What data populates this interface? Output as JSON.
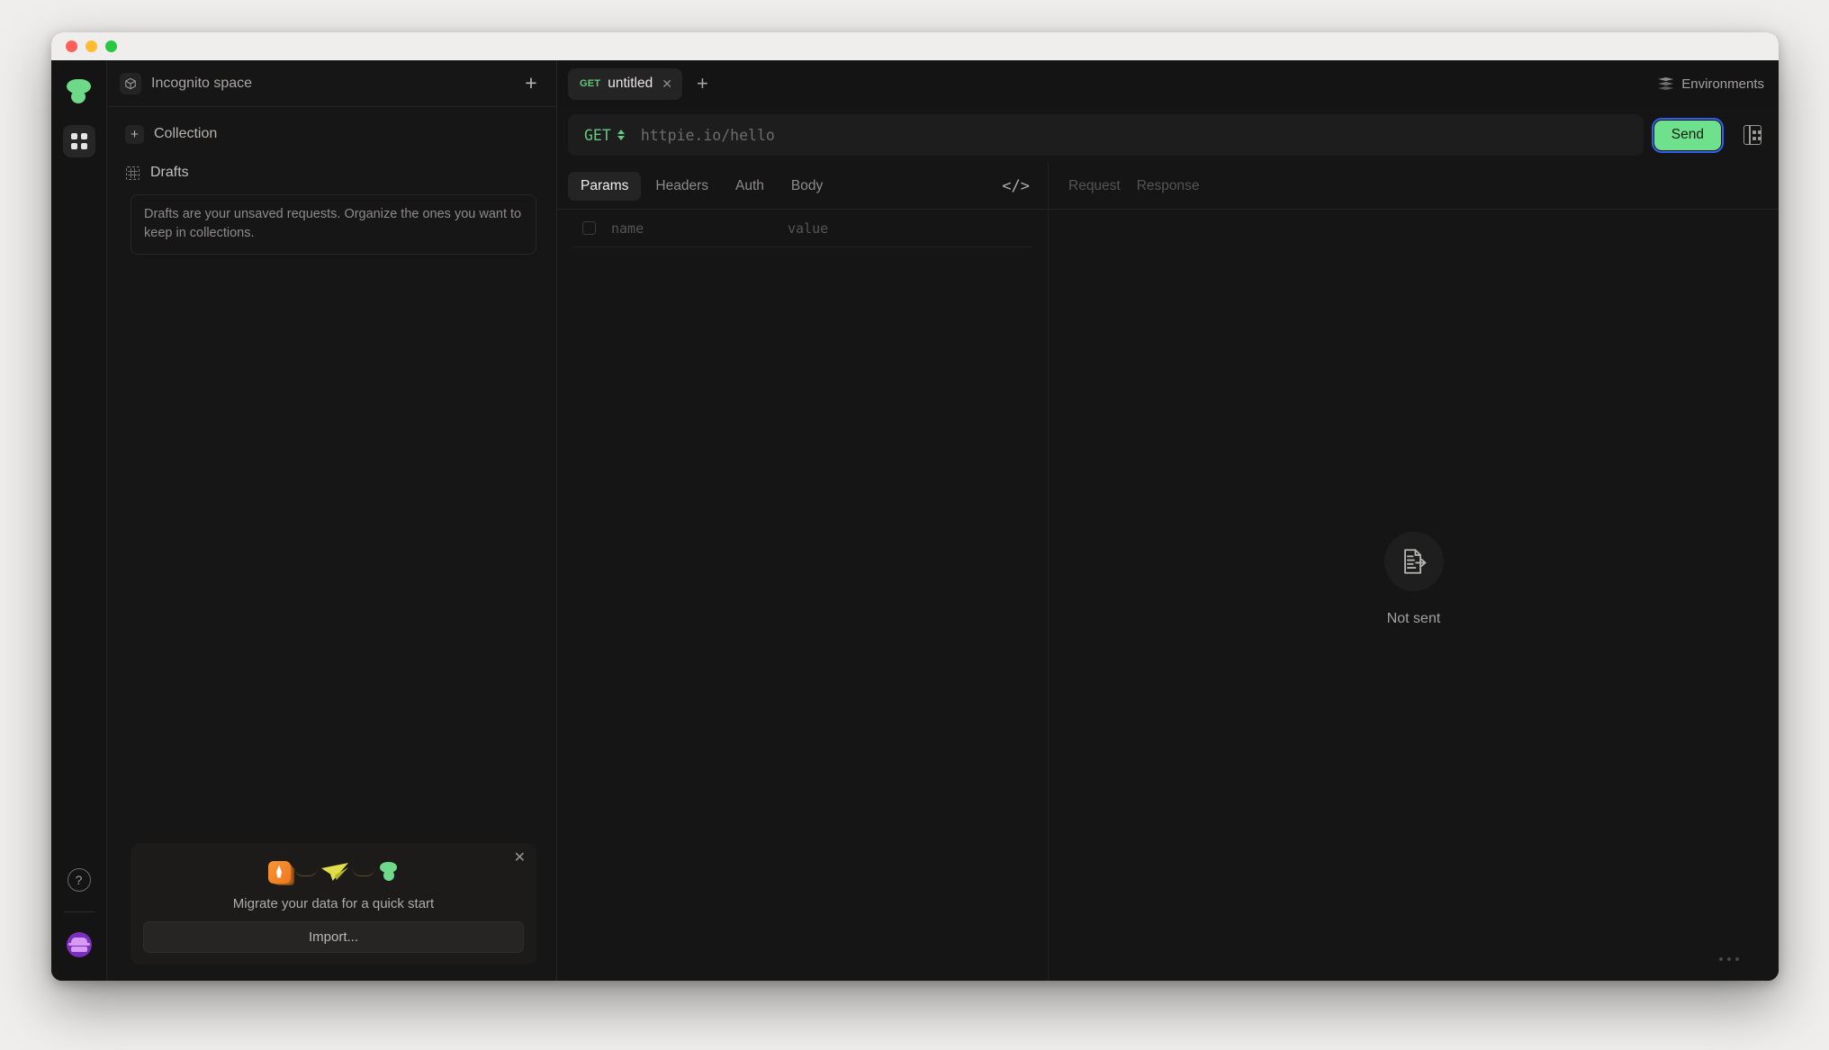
{
  "window": {
    "traffic_lights": [
      "close",
      "minimize",
      "zoom"
    ]
  },
  "rail": {
    "logo_name": "httpie-logo",
    "collections_icon": "grid-apps-icon",
    "help_label": "?",
    "avatar_name": "incognito-avatar"
  },
  "sidebar": {
    "space": {
      "icon": "cube-icon",
      "name": "Incognito space",
      "add_label": "+"
    },
    "collection": {
      "add_label": "+",
      "label": "Collection"
    },
    "drafts": {
      "icon": "dashed-grid-icon",
      "label": "Drafts",
      "note": "Drafts are your unsaved requests. Organize the ones you want to keep in collections."
    },
    "migrate": {
      "close_label": "✕",
      "art": [
        "postman-rocket-icon",
        "insomnia-plane-icon",
        "httpie-logo-icon"
      ],
      "headline": "Migrate your data for a quick start",
      "button_label": "Import..."
    }
  },
  "tabbar": {
    "request_tab": {
      "method": "GET",
      "title": "untitled",
      "close_label": "✕"
    },
    "new_tab_label": "+",
    "environments": {
      "icon": "layers-icon",
      "label": "Environments"
    }
  },
  "urlbar": {
    "method": "GET",
    "method_caret": "up-down-caret-icon",
    "url_value": "",
    "url_placeholder": "httpie.io/hello",
    "send_label": "Send",
    "send_color": "#6fe08c",
    "focus_ring_color": "#2f61ee",
    "side_button_icon": "table-columns-icon"
  },
  "request_pane": {
    "tabs": [
      {
        "label": "Params",
        "active": true
      },
      {
        "label": "Headers",
        "active": false
      },
      {
        "label": "Auth",
        "active": false
      },
      {
        "label": "Body",
        "active": false
      }
    ],
    "code_icon": "code-brackets-icon",
    "params": {
      "name_placeholder": "name",
      "value_placeholder": "value"
    }
  },
  "response_pane": {
    "tabs": [
      {
        "label": "Request"
      },
      {
        "label": "Response"
      }
    ],
    "empty": {
      "icon": "document-send-icon",
      "label": "Not sent"
    },
    "overflow_label": "…"
  },
  "colors": {
    "accent_green": "#6fd98a",
    "method_green": "#62c97e",
    "window_bg": "#151515",
    "panel_bg": "#161616",
    "titlebar_bg": "#efeeec"
  }
}
